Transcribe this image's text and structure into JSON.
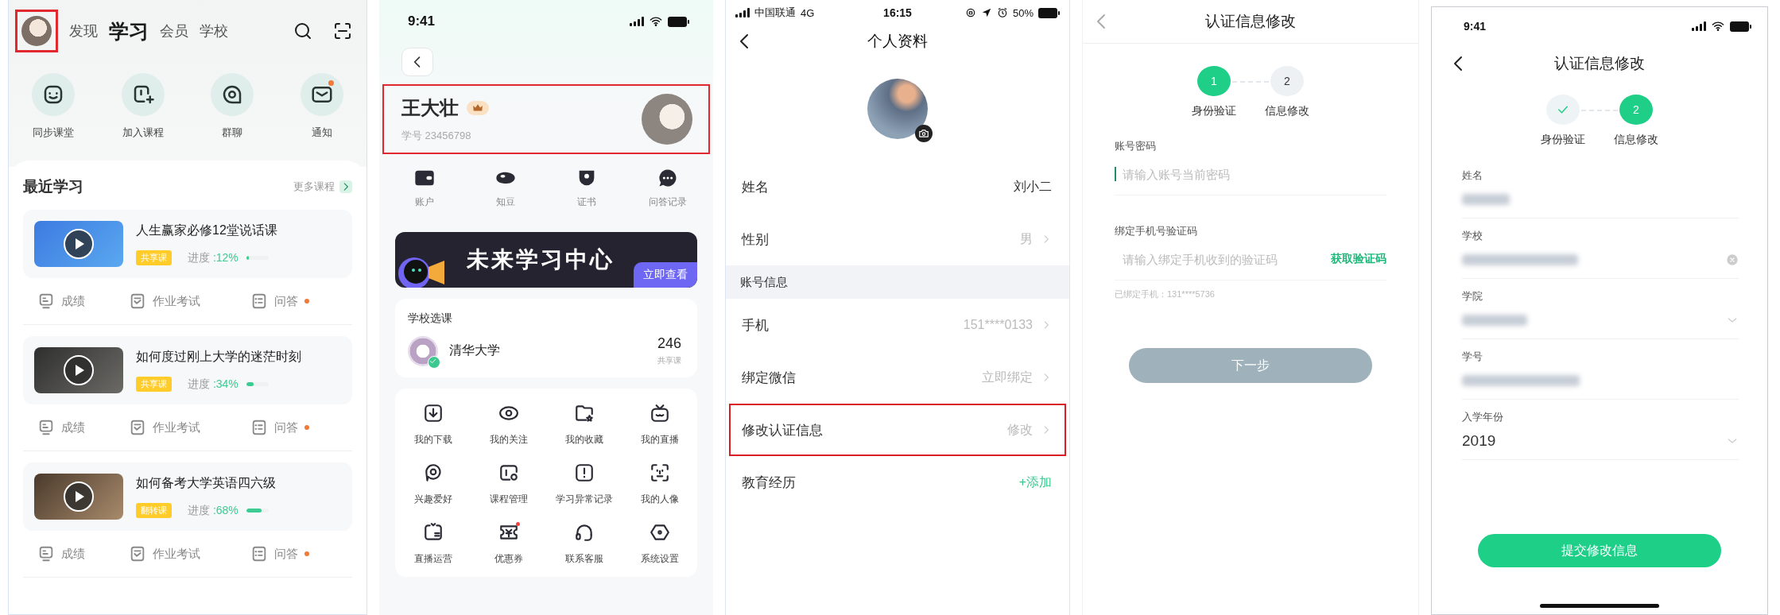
{
  "home": {
    "avatar": {
      "highlighted": true
    },
    "nav": [
      {
        "label": "发现",
        "selected": false
      },
      {
        "label": "学习",
        "selected": true
      },
      {
        "label": "会员",
        "selected": false
      },
      {
        "label": "学校",
        "selected": false
      }
    ],
    "quick_actions": [
      {
        "label": "同步课堂",
        "unread": false
      },
      {
        "label": "加入课程",
        "unread": false
      },
      {
        "label": "群聊",
        "unread": false
      },
      {
        "label": "通知",
        "unread": true
      }
    ],
    "section_title": "最近学习",
    "more_link": "更多课程",
    "courses": [
      {
        "title": "人生赢家必修12堂说话课",
        "tag": "共享课",
        "progress_label": "进度",
        "progress": ":12%",
        "level": 0.12,
        "actions": [
          {
            "label": "成绩",
            "unread": false
          },
          {
            "label": "作业考试",
            "unread": false
          },
          {
            "label": "问答",
            "unread": true
          }
        ]
      },
      {
        "title": "如何度过刚上大学的迷茫时刻",
        "tag": "共享课",
        "progress_label": "进度",
        "progress": ":34%",
        "level": 0.34,
        "actions": [
          {
            "label": "成绩",
            "unread": false
          },
          {
            "label": "作业考试",
            "unread": false
          },
          {
            "label": "问答",
            "unread": true
          }
        ]
      },
      {
        "title": "如何备考大学英语四六级",
        "tag": "翻转课",
        "progress_label": "进度",
        "progress": ":68%",
        "level": 0.68,
        "actions": [
          {
            "label": "成绩",
            "unread": false
          },
          {
            "label": "作业考试",
            "unread": false
          },
          {
            "label": "问答",
            "unread": true
          }
        ]
      }
    ]
  },
  "profile": {
    "status_time": "9:41",
    "name": "王大壮",
    "vip": true,
    "student_id": "学号 23456798",
    "highlighted": true,
    "shortcuts": [
      {
        "label": "账户"
      },
      {
        "label": "知豆"
      },
      {
        "label": "证书"
      },
      {
        "label": "问答记录"
      }
    ],
    "banner": {
      "title": "未来学习中心",
      "button": "立即查看"
    },
    "school_card": {
      "title": "学校选课",
      "school": "清华大学",
      "verified": true,
      "count": "246",
      "count_label": "共享课"
    },
    "tools": [
      {
        "label": "我的下载"
      },
      {
        "label": "我的关注"
      },
      {
        "label": "我的收藏"
      },
      {
        "label": "我的直播"
      },
      {
        "label": "兴趣爱好"
      },
      {
        "label": "课程管理"
      },
      {
        "label": "学习异常记录"
      },
      {
        "label": "我的人像"
      },
      {
        "label": "直播运营"
      },
      {
        "label": "优惠券",
        "unread": true
      },
      {
        "label": "联系客服"
      },
      {
        "label": "系统设置"
      }
    ]
  },
  "personal_info": {
    "status": {
      "carrier": "中国联通",
      "network": "4G",
      "time": "16:15",
      "battery": "50%"
    },
    "title": "个人资料",
    "rows": [
      {
        "kind": "value",
        "label": "姓名",
        "value": "刘小二",
        "highlighted": false
      },
      {
        "kind": "link",
        "label": "性别",
        "value": "男",
        "highlighted": false
      },
      {
        "kind": "section",
        "label": "账号信息"
      },
      {
        "kind": "link",
        "label": "手机",
        "value": "151****0133",
        "highlighted": false
      },
      {
        "kind": "link",
        "label": "绑定微信",
        "value": "立即绑定",
        "highlighted": false
      },
      {
        "kind": "link",
        "label": "修改认证信息",
        "value": "修改",
        "highlighted": true
      },
      {
        "kind": "add",
        "label": "教育经历",
        "value": "+添加",
        "highlighted": false
      }
    ]
  },
  "verify_step1": {
    "title": "认证信息修改",
    "steps": [
      {
        "number": "1",
        "label": "身份验证",
        "selected": true,
        "done": false
      },
      {
        "number": "2",
        "label": "信息修改",
        "selected": false,
        "done": false
      }
    ],
    "fields": [
      {
        "label": "账号密码",
        "placeholder": "请输入账号当前密码",
        "focused": true
      },
      {
        "label": "绑定手机号验证码",
        "placeholder": "请输入绑定手机收到的验证码",
        "focused": false,
        "action": "获取验证码",
        "hint": "已绑定手机：131****5736"
      }
    ],
    "button": {
      "label": "下一步",
      "disabled": true
    }
  },
  "verify_step2": {
    "status_time": "9:41",
    "title": "认证信息修改",
    "steps": [
      {
        "label": "身份验证",
        "selected": false,
        "done": true
      },
      {
        "number": "2",
        "label": "信息修改",
        "selected": true,
        "done": false
      }
    ],
    "fields": [
      {
        "label": "姓名",
        "kind": "blurred",
        "clearable": false,
        "dropdown": false
      },
      {
        "label": "学校",
        "kind": "blurred",
        "clearable": true,
        "dropdown": false
      },
      {
        "label": "学院",
        "kind": "blurred",
        "clearable": false,
        "dropdown": true
      },
      {
        "label": "学号",
        "kind": "blurred",
        "clearable": false,
        "dropdown": false
      },
      {
        "label": "入学年份",
        "kind": "value",
        "value": "2019",
        "clearable": false,
        "dropdown": true
      }
    ],
    "button": {
      "label": "提交修改信息",
      "disabled": false
    }
  }
}
